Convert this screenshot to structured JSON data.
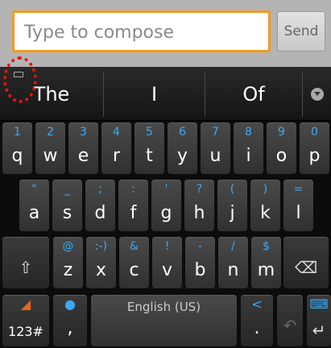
{
  "compose": {
    "placeholder": "Type to compose",
    "send_label": "Send"
  },
  "suggestions": [
    "The",
    "I",
    "Of"
  ],
  "row1": [
    {
      "hint": "1",
      "main": "q"
    },
    {
      "hint": "2",
      "main": "w"
    },
    {
      "hint": "3",
      "main": "e"
    },
    {
      "hint": "4",
      "main": "r"
    },
    {
      "hint": "5",
      "main": "t"
    },
    {
      "hint": "6",
      "main": "y"
    },
    {
      "hint": "7",
      "main": "u"
    },
    {
      "hint": "8",
      "main": "i"
    },
    {
      "hint": "9",
      "main": "o"
    },
    {
      "hint": "0",
      "main": "p"
    }
  ],
  "row2": [
    {
      "hint": "\"",
      "main": "a"
    },
    {
      "hint": "_",
      "main": "s"
    },
    {
      "hint": ";",
      "main": "d"
    },
    {
      "hint": ":",
      "main": "f"
    },
    {
      "hint": "'",
      "main": "g"
    },
    {
      "hint": "?",
      "main": "h"
    },
    {
      "hint": "(",
      "main": "j"
    },
    {
      "hint": ")",
      "main": "k"
    },
    {
      "hint": "=",
      "main": "l"
    }
  ],
  "row3": [
    {
      "hint": "@",
      "main": "z"
    },
    {
      "hint": ":-)",
      "main": "x"
    },
    {
      "hint": "&",
      "main": "c"
    },
    {
      "hint": "!",
      "main": "v"
    },
    {
      "hint": "-",
      "main": "b"
    },
    {
      "hint": "/",
      "main": "n"
    },
    {
      "hint": "$",
      "main": "m"
    }
  ],
  "bottom": {
    "symbols_label": "123#",
    "comma": ",",
    "language": "English (US)",
    "period": "."
  },
  "icons": {
    "shift": "shift-icon",
    "backspace": "backspace-icon",
    "mic": "microphone-icon",
    "settings": "swype-settings-icon",
    "share": "share-icon",
    "undo": "undo-icon",
    "enter": "enter-icon",
    "keyboard": "keyboard-icon",
    "expand": "expand-suggestions-icon"
  },
  "colors": {
    "accent": "#3da8f5",
    "input_border": "#f39a1e",
    "highlight": "#e11111"
  }
}
